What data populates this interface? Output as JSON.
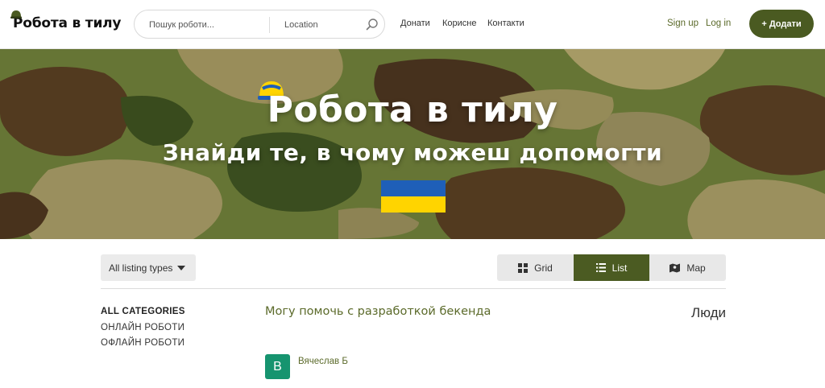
{
  "header": {
    "logo_text": "Робота в тилу",
    "search": {
      "keyword_placeholder": "Пошук роботи...",
      "location_placeholder": "Location"
    },
    "nav": [
      {
        "label": "Донати"
      },
      {
        "label": "Корисне"
      },
      {
        "label": "Контакти"
      }
    ],
    "signup_label": "Sign up",
    "login_label": "Log in",
    "add_label": "+ Додати"
  },
  "hero": {
    "title": "Робота в тилу",
    "subtitle": "Знайди те, в чому можеш допомогти",
    "flag_colors": [
      "#1f5fb8",
      "#ffd400"
    ]
  },
  "toolbar": {
    "listing_types_label": "All listing types",
    "views": [
      {
        "label": "Grid",
        "icon": "grid-icon",
        "active": false
      },
      {
        "label": "List",
        "icon": "list-icon",
        "active": true
      },
      {
        "label": "Map",
        "icon": "map-icon",
        "active": false
      }
    ]
  },
  "sidebar": {
    "heading": "ALL CATEGORIES",
    "items": [
      {
        "label": "ОНЛАЙН РОБОТИ"
      },
      {
        "label": "ОФЛАЙН РОБОТИ"
      }
    ]
  },
  "listing": {
    "title": "Могу помочь с разработкой бекенда",
    "type": "Люди",
    "author_initial": "B",
    "author_name": "Вячеслав Б"
  },
  "colors": {
    "brand": "#4a5a21",
    "link": "#5b6a2a",
    "avatar": "#16946f"
  }
}
